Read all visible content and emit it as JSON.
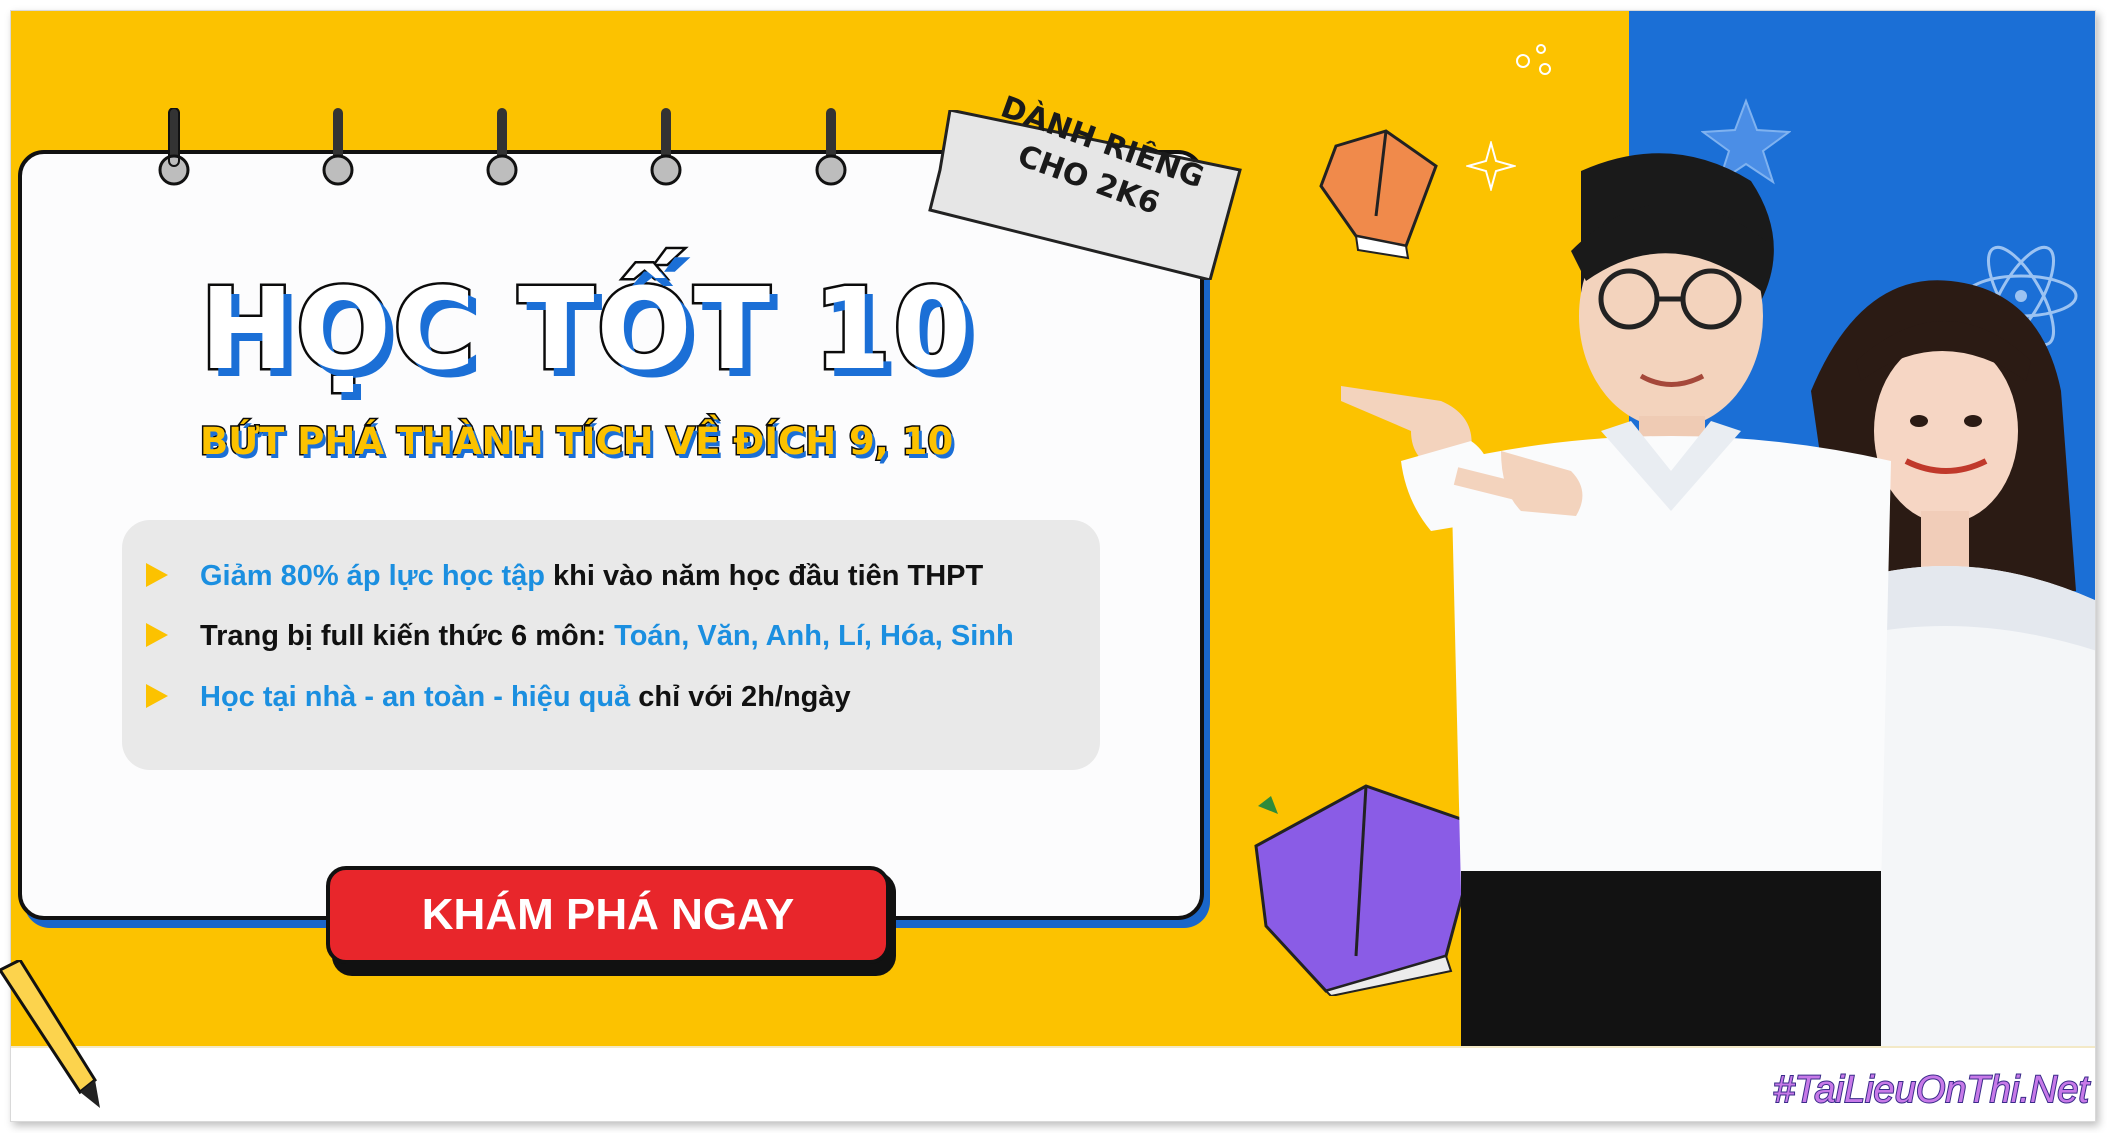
{
  "banner": {
    "badge_line1": "DÀNH RIÊNG",
    "badge_line2": "CHO 2K6",
    "title": "HỌC TỐT 10",
    "subtitle": "BỨT PHÁ THÀNH TÍCH VỀ ĐÍCH 9, 10",
    "features": [
      {
        "highlight": "Giảm 80% áp lực học tập",
        "text": " khi vào năm học đầu tiên THPT"
      },
      {
        "text": "Trang bị full kiến thức 6 môn: ",
        "highlight": "Toán, Văn, Anh, Lí, Hóa, Sinh"
      },
      {
        "highlight": "Học tại nhà - an toàn - hiệu quả",
        "text": " chỉ với 2h/ngày"
      }
    ],
    "cta_label": "KHÁM PHÁ NGAY"
  },
  "watermark": "#TaiLieuOnThi.Net",
  "colors": {
    "yellow": "#fcc200",
    "blue": "#1b6fd6",
    "highlight": "#1b8fe0",
    "cta_red": "#e8262b"
  },
  "icons": [
    "ring-binder-icon",
    "book-icon",
    "star-icon",
    "atom-icon",
    "pencil-icon"
  ]
}
